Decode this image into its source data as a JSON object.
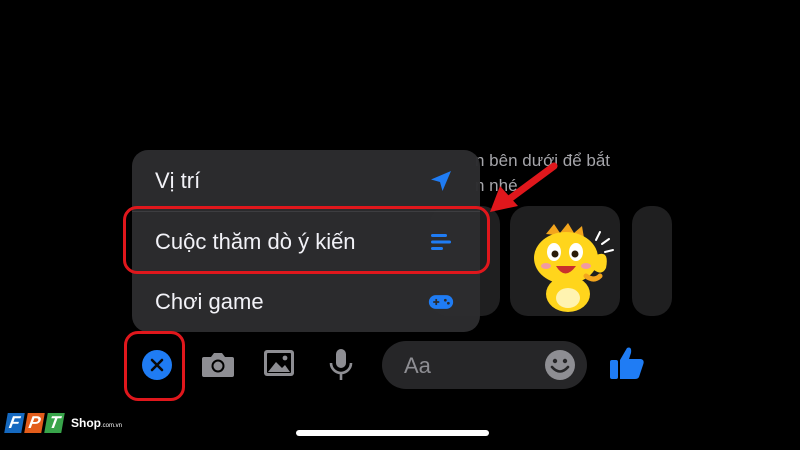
{
  "background_hint": {
    "line1": "n bên dưới để bắt",
    "line2": "n nhé"
  },
  "menu": {
    "items": [
      {
        "label": "Vị trí",
        "icon": "location-arrow-icon"
      },
      {
        "label": "Cuộc thăm dò ý kiến",
        "icon": "poll-icon"
      },
      {
        "label": "Chơi game",
        "icon": "game-controller-icon"
      }
    ]
  },
  "composer": {
    "close_icon": "close-icon",
    "camera_icon": "camera-icon",
    "gallery_icon": "gallery-icon",
    "mic_icon": "microphone-icon",
    "input_placeholder": "Aa",
    "emoji_icon": "emoji-icon",
    "like_icon": "thumbs-up-icon"
  },
  "logo": {
    "letters": [
      "F",
      "P",
      "T"
    ],
    "shop": "Shop",
    "domain": ".com.vn"
  },
  "colors": {
    "accent": "#1f7cf4",
    "annotation": "#e0171c",
    "menu_bg": "#2c2c2e"
  }
}
